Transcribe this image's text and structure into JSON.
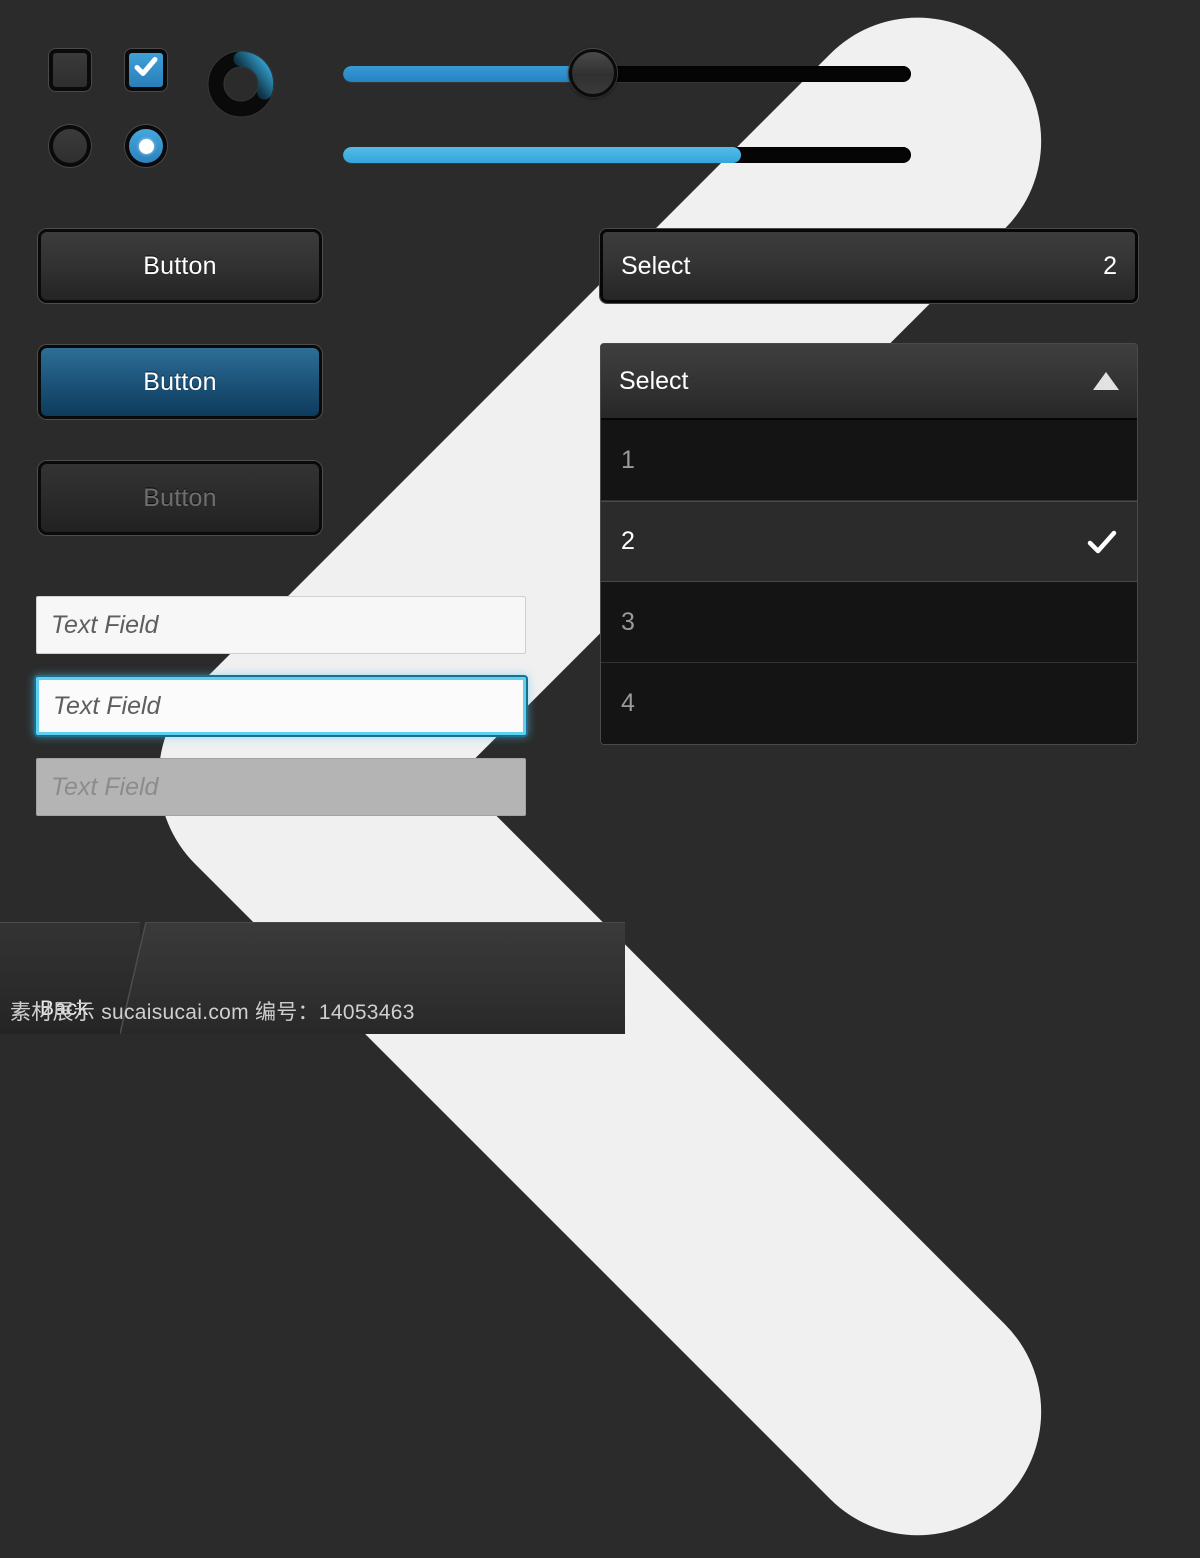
{
  "theme": {
    "background": "#2b2b2b",
    "accent_blue": "#2a8ac8",
    "accent_light_blue": "#43b0de",
    "focus_glow": "#5fd0f0",
    "text_primary": "#ffffff",
    "text_muted": "#9a9a9a",
    "text_disabled": "#6e6e6e"
  },
  "controls": {
    "checkbox_unchecked": {
      "name": "checkbox",
      "state": "unchecked",
      "label": ""
    },
    "checkbox_checked": {
      "name": "checkbox",
      "state": "checked",
      "icon": "check-icon",
      "label": ""
    },
    "radio_unselected": {
      "name": "radio-button",
      "state": "unselected",
      "label": ""
    },
    "radio_selected": {
      "name": "radio-button",
      "state": "selected",
      "label": ""
    },
    "spinner": {
      "name": "loading-spinner",
      "icon": "spinner-icon",
      "state": "loading"
    }
  },
  "slider": {
    "name": "slider",
    "value_percent": 44,
    "min": 0,
    "max": 100
  },
  "progress": {
    "name": "progress-bar",
    "value_percent": 70,
    "min": 0,
    "max": 100
  },
  "buttons": [
    {
      "label": "Button",
      "state": "normal"
    },
    {
      "label": "Button",
      "state": "active"
    },
    {
      "label": "Button",
      "state": "disabled"
    }
  ],
  "text_fields": [
    {
      "placeholder": "Text Field",
      "value": "",
      "state": "normal"
    },
    {
      "placeholder": "Text Field",
      "value": "",
      "state": "focused"
    },
    {
      "placeholder": "Text Field",
      "value": "",
      "state": "disabled"
    }
  ],
  "select_closed": {
    "label": "Select",
    "value": "2",
    "state": "collapsed"
  },
  "select_open": {
    "label": "Select",
    "state": "expanded",
    "caret_icon": "caret-up-icon",
    "options": [
      {
        "label": "1",
        "selected": false
      },
      {
        "label": "2",
        "selected": true
      },
      {
        "label": "3",
        "selected": false
      },
      {
        "label": "4",
        "selected": false
      }
    ]
  },
  "bottom_bar": {
    "back_icon": "chevron-left-icon",
    "back_label": "Back"
  },
  "watermark": {
    "prefix": "素材展示",
    "site": "sucaisucai.com",
    "id_label": "编号：",
    "id_value": "14053463"
  }
}
